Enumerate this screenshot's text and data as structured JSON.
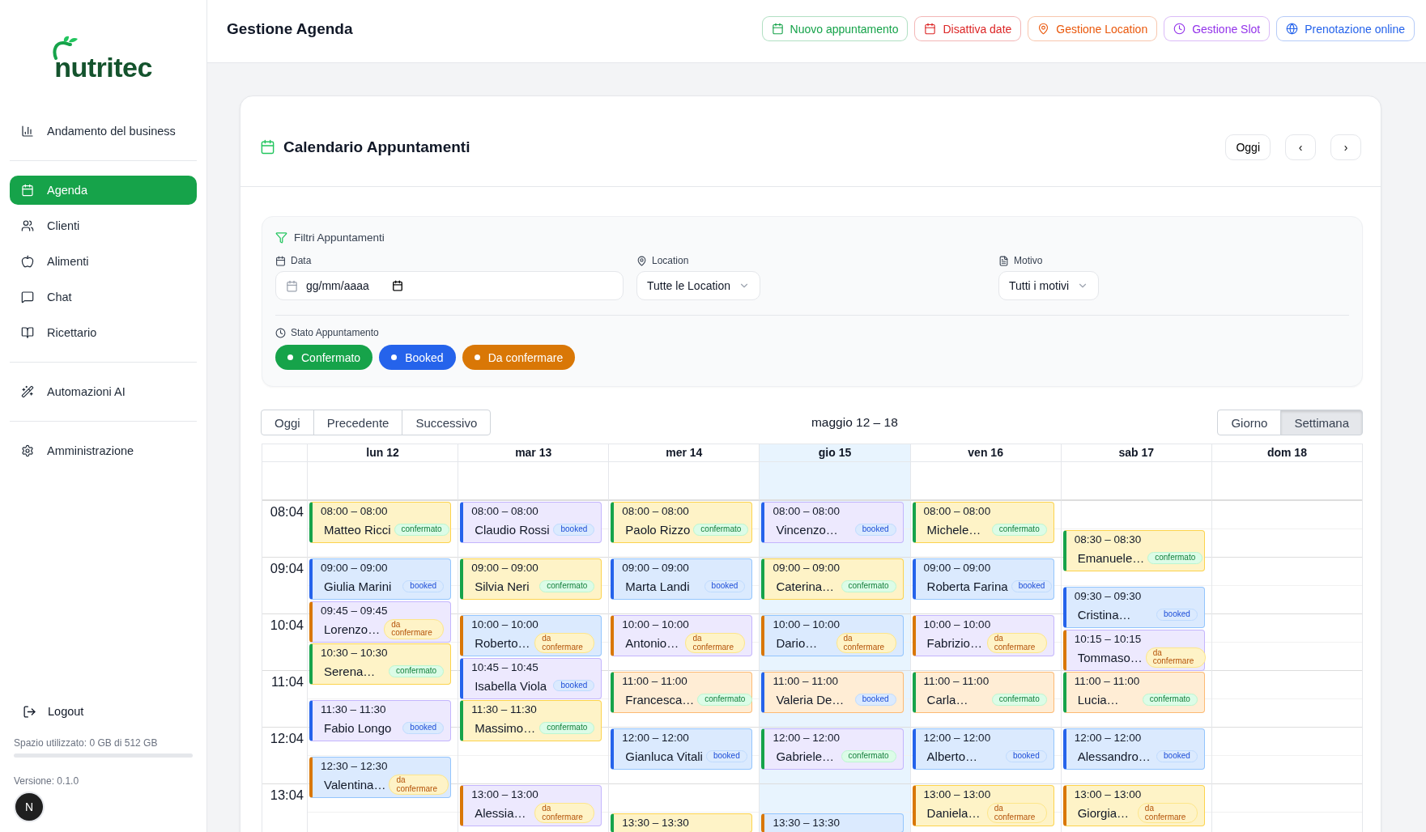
{
  "sidebar": {
    "logo": "nutritec",
    "groups": [
      [
        {
          "label": "Andamento del business",
          "selected": false
        }
      ],
      [
        {
          "label": "Agenda",
          "selected": true
        },
        {
          "label": "Clienti",
          "selected": false
        },
        {
          "label": "Alimenti",
          "selected": false
        },
        {
          "label": "Chat",
          "selected": false
        },
        {
          "label": "Ricettario",
          "selected": false
        }
      ],
      [
        {
          "label": "Automazioni AI",
          "selected": false
        }
      ],
      [
        {
          "label": "Amministrazione",
          "selected": false
        }
      ]
    ],
    "logout": "Logout",
    "storage": {
      "label": "Spazio utilizzato: 0 GB di 512 GB",
      "level": 0
    },
    "version": "Versione: 0.1.0",
    "dev_badge": "N"
  },
  "header": {
    "title": "Gestione Agenda",
    "actions": [
      {
        "label": "Nuovo appuntamento",
        "color": "#16a34a"
      },
      {
        "label": "Disattiva date",
        "color": "#dc2626"
      },
      {
        "label": "Gestione Location",
        "color": "#ea580c"
      },
      {
        "label": "Gestione Slot",
        "color": "#9333ea"
      },
      {
        "label": "Prenotazione online",
        "color": "#2563eb"
      }
    ]
  },
  "card": {
    "title": "Calendario Appuntamenti",
    "today_button": "Oggi",
    "prev_button": "‹",
    "next_button": "›"
  },
  "filters": {
    "title": "Filtri Appuntamenti",
    "date": {
      "label": "Data",
      "placeholder": "gg/mm/aaaa"
    },
    "location": {
      "label": "Location",
      "value": "Tutte le Location"
    },
    "reason": {
      "label": "Motivo",
      "value": "Tutti i motivi"
    },
    "status_label": "Stato Appuntamento",
    "statuses": [
      {
        "label": "Confermato",
        "color": "#16a34a"
      },
      {
        "label": "Booked",
        "color": "#2563eb"
      },
      {
        "label": "Da confermare",
        "color": "#d97706"
      }
    ]
  },
  "calendar": {
    "nav": [
      {
        "label": "Oggi"
      },
      {
        "label": "Precedente"
      },
      {
        "label": "Successivo"
      }
    ],
    "range": "maggio 12 – 18",
    "views": [
      {
        "label": "Giorno",
        "selected": false
      },
      {
        "label": "Settimana",
        "selected": true
      }
    ],
    "hours": [
      "08:04",
      "09:04",
      "10:04",
      "11:04",
      "12:04",
      "13:04"
    ],
    "days": [
      {
        "label": "lun 12",
        "today": false,
        "events": [
          {
            "time": "08:00 – 08:00",
            "name": "Matteo Ricci",
            "kind": "confermato",
            "badge": "confermato",
            "color": "#fef3c7"
          },
          {
            "time": "09:00 – 09:00",
            "name": "Giulia Marini",
            "kind": "booked",
            "badge": "booked",
            "color": "#dbeafe"
          },
          {
            "time": "09:45 – 09:45",
            "name": "Lorenzo…",
            "kind": "da_confermare",
            "badge": "da confermare",
            "color": "#ede9fe"
          },
          {
            "time": "10:30 – 10:30",
            "name": "Serena…",
            "kind": "confermato",
            "badge": "confermato",
            "color": "#fef3c7"
          },
          {
            "time": "11:30 – 11:30",
            "name": "Fabio Longo",
            "kind": "booked",
            "badge": "booked",
            "color": "#ede9fe"
          },
          {
            "time": "12:30 – 12:30",
            "name": "Valentina…",
            "kind": "da_confermare",
            "badge": "da confermare",
            "color": "#dbeafe"
          }
        ]
      },
      {
        "label": "mar 13",
        "today": false,
        "events": [
          {
            "time": "08:00 – 08:00",
            "name": "Claudio Rossi",
            "kind": "booked",
            "badge": "booked",
            "color": "#ede9fe"
          },
          {
            "time": "09:00 – 09:00",
            "name": "Silvia Neri",
            "kind": "confermato",
            "badge": "confermato",
            "color": "#fef3c7"
          },
          {
            "time": "10:00 – 10:00",
            "name": "Roberto…",
            "kind": "da_confermare",
            "badge": "da confermare",
            "color": "#dbeafe"
          },
          {
            "time": "10:45 – 10:45",
            "name": "Isabella Viola",
            "kind": "booked",
            "badge": "booked",
            "color": "#ede9fe"
          },
          {
            "time": "11:30 – 11:30",
            "name": "Massimo…",
            "kind": "confermato",
            "badge": "confermato",
            "color": "#fef3c7"
          },
          {
            "time": "13:00 – 13:00",
            "name": "Alessia…",
            "kind": "da_confermare",
            "badge": "da confermare",
            "color": "#ede9fe"
          }
        ]
      },
      {
        "label": "mer 14",
        "today": false,
        "events": [
          {
            "time": "08:00 – 08:00",
            "name": "Paolo Rizzo",
            "kind": "confermato",
            "badge": "confermato",
            "color": "#fef3c7"
          },
          {
            "time": "09:00 – 09:00",
            "name": "Marta Landi",
            "kind": "booked",
            "badge": "booked",
            "color": "#dbeafe"
          },
          {
            "time": "10:00 – 10:00",
            "name": "Antonio…",
            "kind": "da_confermare",
            "badge": "da confermare",
            "color": "#ede9fe"
          },
          {
            "time": "11:00 – 11:00",
            "name": "Francesca…",
            "kind": "confermato",
            "badge": "confermato",
            "color": "#ffedd5"
          },
          {
            "time": "12:00 – 12:00",
            "name": "Gianluca Vitali",
            "kind": "booked",
            "badge": "booked",
            "color": "#dbeafe"
          },
          {
            "time": "13:30 – 13:30",
            "kind": "confermato",
            "color": "#fef3c7"
          }
        ]
      },
      {
        "label": "gio 15",
        "today": true,
        "events": [
          {
            "time": "08:00 – 08:00",
            "name": "Vincenzo…",
            "kind": "booked",
            "badge": "booked",
            "color": "#ede9fe"
          },
          {
            "time": "09:00 – 09:00",
            "name": "Caterina…",
            "kind": "confermato",
            "badge": "confermato",
            "color": "#fef3c7"
          },
          {
            "time": "10:00 – 10:00",
            "name": "Dario…",
            "kind": "da_confermare",
            "badge": "da confermare",
            "color": "#dbeafe"
          },
          {
            "time": "11:00 – 11:00",
            "name": "Valeria De…",
            "kind": "booked",
            "badge": "booked",
            "color": "#ffedd5"
          },
          {
            "time": "12:00 – 12:00",
            "name": "Gabriele…",
            "kind": "confermato",
            "badge": "confermato",
            "color": "#ede9fe"
          },
          {
            "time": "13:30 – 13:30",
            "kind": "da_confermare",
            "color": "#dbeafe"
          }
        ]
      },
      {
        "label": "ven 16",
        "today": false,
        "events": [
          {
            "time": "08:00 – 08:00",
            "name": "Michele…",
            "kind": "confermato",
            "badge": "confermato",
            "color": "#fef3c7"
          },
          {
            "time": "09:00 – 09:00",
            "name": "Roberta Farina",
            "kind": "booked",
            "badge": "booked",
            "color": "#dbeafe"
          },
          {
            "time": "10:00 – 10:00",
            "name": "Fabrizio…",
            "kind": "da_confermare",
            "badge": "da confermare",
            "color": "#ede9fe"
          },
          {
            "time": "11:00 – 11:00",
            "name": "Carla…",
            "kind": "confermato",
            "badge": "confermato",
            "color": "#ffedd5"
          },
          {
            "time": "12:00 – 12:00",
            "name": "Alberto…",
            "kind": "booked",
            "badge": "booked",
            "color": "#dbeafe"
          },
          {
            "time": "13:00 – 13:00",
            "name": "Daniela…",
            "kind": "da_confermare",
            "badge": "da confermare",
            "color": "#fef3c7"
          }
        ]
      },
      {
        "label": "sab 17",
        "today": false,
        "events": [
          {
            "time": "08:30 – 08:30",
            "name": "Emanuele…",
            "kind": "confermato",
            "badge": "confermato",
            "color": "#fef3c7"
          },
          {
            "time": "09:30 – 09:30",
            "name": "Cristina…",
            "kind": "booked",
            "badge": "booked",
            "color": "#dbeafe"
          },
          {
            "time": "10:15 – 10:15",
            "name": "Tommaso…",
            "kind": "da_confermare",
            "badge": "da confermare",
            "color": "#ede9fe"
          },
          {
            "time": "11:00 – 11:00",
            "name": "Lucia…",
            "kind": "confermato",
            "badge": "confermato",
            "color": "#ffedd5"
          },
          {
            "time": "12:00 – 12:00",
            "name": "Alessandro…",
            "kind": "booked",
            "badge": "booked",
            "color": "#dbeafe"
          },
          {
            "time": "13:00 – 13:00",
            "name": "Giorgia…",
            "kind": "da_confermare",
            "badge": "da confermare",
            "color": "#fef3c7"
          }
        ]
      },
      {
        "label": "dom 18",
        "today": false
      }
    ]
  }
}
